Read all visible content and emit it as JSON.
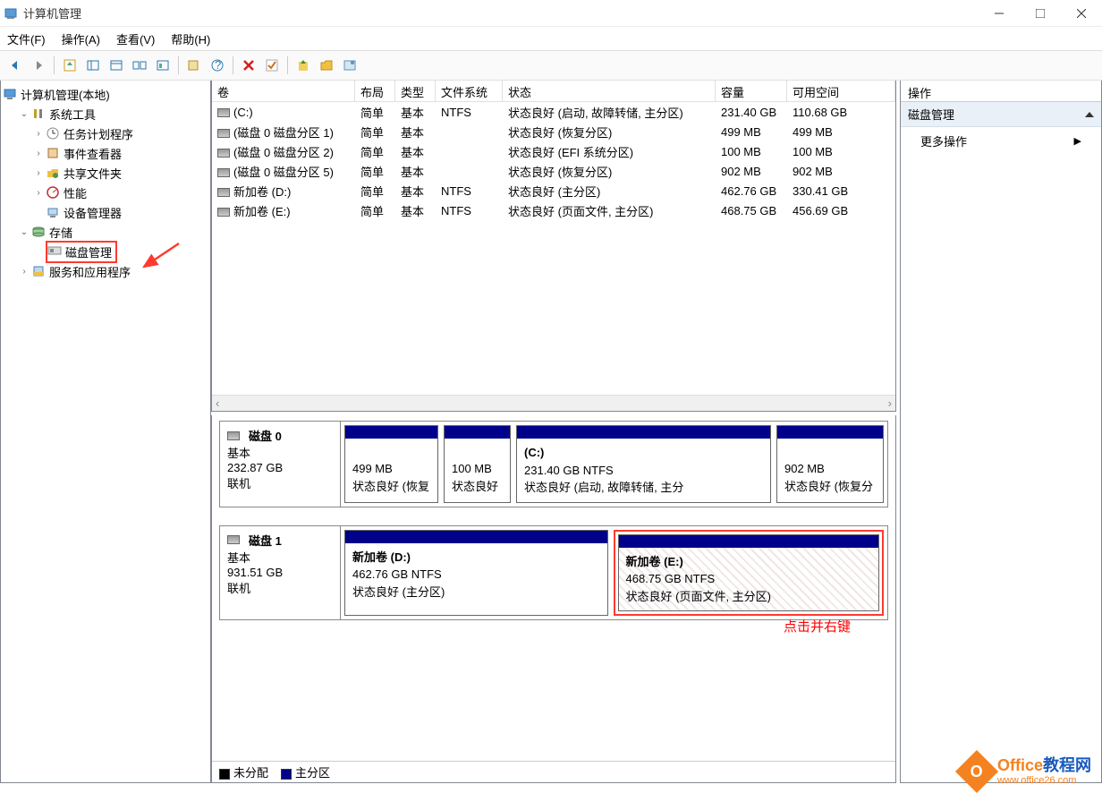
{
  "window": {
    "title": "计算机管理"
  },
  "menus": {
    "file": "文件(F)",
    "action": "操作(A)",
    "view": "查看(V)",
    "help": "帮助(H)"
  },
  "tree": {
    "root": "计算机管理(本地)",
    "system_tools": "系统工具",
    "task_scheduler": "任务计划程序",
    "event_viewer": "事件查看器",
    "shared_folders": "共享文件夹",
    "performance": "性能",
    "device_manager": "设备管理器",
    "storage": "存储",
    "disk_management": "磁盘管理",
    "services": "服务和应用程序"
  },
  "vol_headers": {
    "volume": "卷",
    "layout": "布局",
    "type": "类型",
    "fs": "文件系统",
    "status": "状态",
    "capacity": "容量",
    "free": "可用空间"
  },
  "volumes": [
    {
      "name": "(C:)",
      "layout": "简单",
      "type": "基本",
      "fs": "NTFS",
      "status": "状态良好 (启动, 故障转储, 主分区)",
      "cap": "231.40 GB",
      "free": "110.68 GB"
    },
    {
      "name": "(磁盘 0 磁盘分区 1)",
      "layout": "简单",
      "type": "基本",
      "fs": "",
      "status": "状态良好 (恢复分区)",
      "cap": "499 MB",
      "free": "499 MB"
    },
    {
      "name": "(磁盘 0 磁盘分区 2)",
      "layout": "简单",
      "type": "基本",
      "fs": "",
      "status": "状态良好 (EFI 系统分区)",
      "cap": "100 MB",
      "free": "100 MB"
    },
    {
      "name": "(磁盘 0 磁盘分区 5)",
      "layout": "简单",
      "type": "基本",
      "fs": "",
      "status": "状态良好 (恢复分区)",
      "cap": "902 MB",
      "free": "902 MB"
    },
    {
      "name": "新加卷 (D:)",
      "layout": "简单",
      "type": "基本",
      "fs": "NTFS",
      "status": "状态良好 (主分区)",
      "cap": "462.76 GB",
      "free": "330.41 GB"
    },
    {
      "name": "新加卷 (E:)",
      "layout": "简单",
      "type": "基本",
      "fs": "NTFS",
      "status": "状态良好 (页面文件, 主分区)",
      "cap": "468.75 GB",
      "free": "456.69 GB"
    }
  ],
  "disk0": {
    "label": "磁盘 0",
    "type": "基本",
    "size": "232.87 GB",
    "state": "联机",
    "p1": {
      "size": "499 MB",
      "status": "状态良好 (恢复"
    },
    "p2": {
      "size": "100 MB",
      "status": "状态良好"
    },
    "p3": {
      "name": "(C:)",
      "size": "231.40 GB NTFS",
      "status": "状态良好 (启动, 故障转储, 主分"
    },
    "p4": {
      "size": "902 MB",
      "status": "状态良好 (恢复分"
    }
  },
  "disk1": {
    "label": "磁盘 1",
    "type": "基本",
    "size": "931.51 GB",
    "state": "联机",
    "p1": {
      "name": "新加卷  (D:)",
      "size": "462.76 GB NTFS",
      "status": "状态良好 (主分区)"
    },
    "p2": {
      "name": "新加卷  (E:)",
      "size": "468.75 GB NTFS",
      "status": "状态良好 (页面文件, 主分区)"
    }
  },
  "annotation": "点击并右键",
  "legend": {
    "unalloc": "未分配",
    "primary": "主分区"
  },
  "actions": {
    "header": "操作",
    "disk_mgmt": "磁盘管理",
    "more": "更多操作"
  },
  "watermark": {
    "brand": "Office",
    "cn": "教程网",
    "url": "www.office26.com"
  }
}
